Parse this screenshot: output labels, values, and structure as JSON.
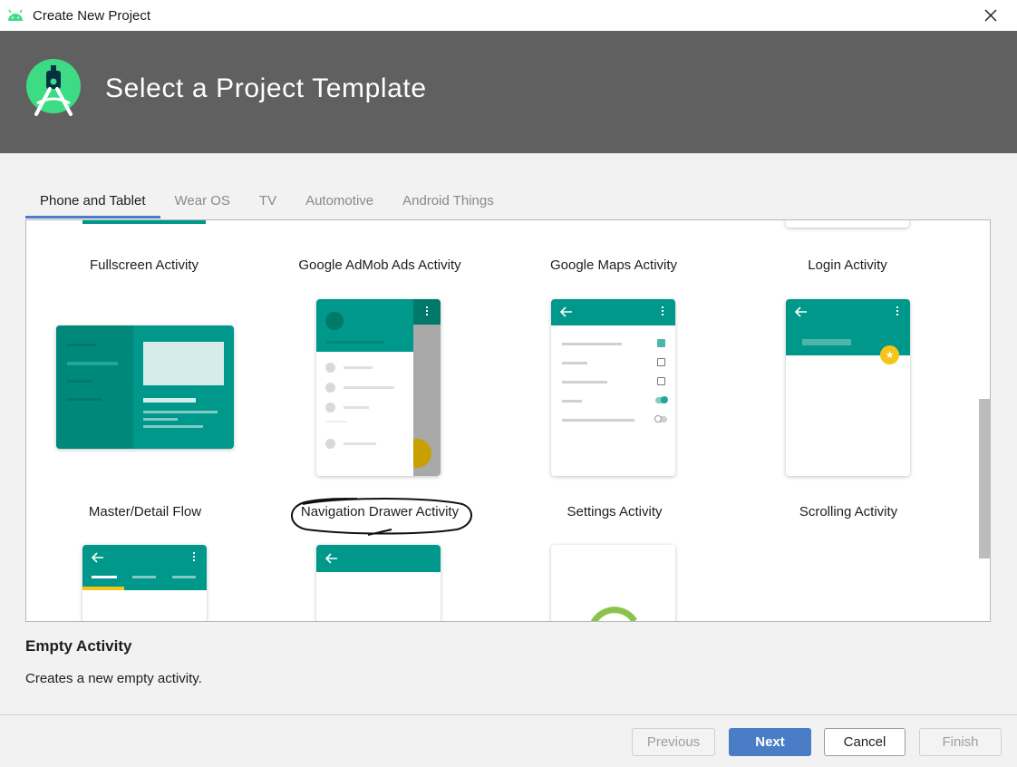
{
  "window": {
    "title": "Create New Project"
  },
  "header": {
    "title": "Select a Project Template"
  },
  "tabs": [
    {
      "label": "Phone and Tablet",
      "active": true
    },
    {
      "label": "Wear OS",
      "active": false
    },
    {
      "label": "TV",
      "active": false
    },
    {
      "label": "Automotive",
      "active": false
    },
    {
      "label": "Android Things",
      "active": false
    }
  ],
  "templates": {
    "row1": [
      "Fullscreen Activity",
      "Google AdMob Ads Activity",
      "Google Maps Activity",
      "Login Activity"
    ],
    "row2": [
      "Master/Detail Flow",
      "Navigation Drawer Activity",
      "Settings Activity",
      "Scrolling Activity"
    ]
  },
  "selected": {
    "title": "Empty Activity",
    "description": "Creates a new empty activity."
  },
  "buttons": {
    "previous": "Previous",
    "next": "Next",
    "cancel": "Cancel",
    "finish": "Finish"
  },
  "colors": {
    "teal": "#00988a",
    "teal_dark": "#00796b",
    "accent_blue": "#4a7dc5",
    "fab_yellow": "#f5c518",
    "header_gray": "#606060"
  }
}
